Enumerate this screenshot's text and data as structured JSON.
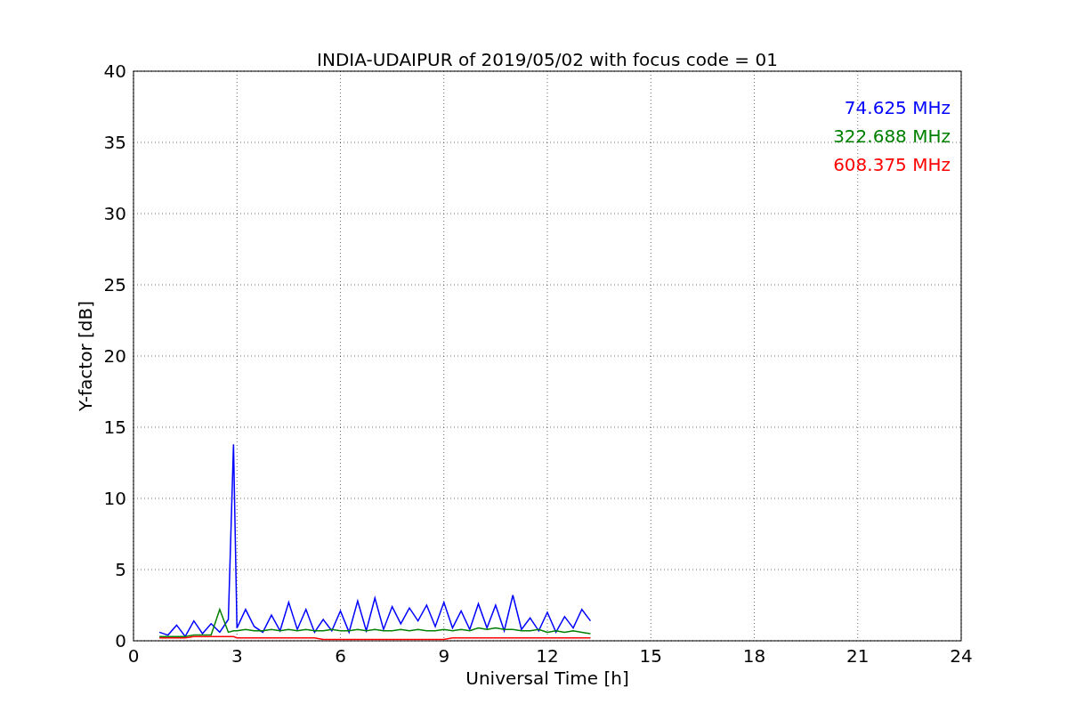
{
  "chart_data": {
    "type": "line",
    "title": "INDIA-UDAIPUR of 2019/05/02 with focus code = 01",
    "xlabel": "Universal Time [h]",
    "ylabel": "Y-factor [dB]",
    "x": [
      0.75,
      1,
      1.25,
      1.5,
      1.75,
      2,
      2.25,
      2.5,
      2.75,
      2.9,
      3,
      3.25,
      3.5,
      3.75,
      4,
      4.25,
      4.5,
      4.75,
      5,
      5.25,
      5.5,
      5.75,
      6,
      6.25,
      6.5,
      6.75,
      7,
      7.25,
      7.5,
      7.75,
      8,
      8.25,
      8.5,
      8.75,
      9,
      9.25,
      9.5,
      9.75,
      10,
      10.25,
      10.5,
      10.75,
      11,
      11.25,
      11.5,
      11.75,
      12,
      12.25,
      12.5,
      12.75,
      13,
      13.25
    ],
    "series": [
      {
        "name": "74.625 MHz",
        "color": "#0000ff",
        "values": [
          0.6,
          0.4,
          1.1,
          0.3,
          1.4,
          0.5,
          1.2,
          0.6,
          1.5,
          13.8,
          0.9,
          2.2,
          1.0,
          0.6,
          1.8,
          0.7,
          2.7,
          0.8,
          2.2,
          0.6,
          1.5,
          0.7,
          2.1,
          0.6,
          2.8,
          0.7,
          3.0,
          0.8,
          2.4,
          1.2,
          2.3,
          1.4,
          2.5,
          1.0,
          2.7,
          0.9,
          2.1,
          0.8,
          2.6,
          0.9,
          2.5,
          0.7,
          3.2,
          0.8,
          1.6,
          0.7,
          2.0,
          0.6,
          1.7,
          0.9,
          2.2,
          1.4
        ]
      },
      {
        "name": "322.688 MHz",
        "color": "#008000",
        "values": [
          0.3,
          0.3,
          0.3,
          0.3,
          0.4,
          0.4,
          0.4,
          2.2,
          0.6,
          0.7,
          0.7,
          0.8,
          0.7,
          0.7,
          0.8,
          0.7,
          0.8,
          0.7,
          0.8,
          0.7,
          0.7,
          0.8,
          0.7,
          0.7,
          0.8,
          0.7,
          0.8,
          0.7,
          0.7,
          0.8,
          0.7,
          0.8,
          0.7,
          0.7,
          0.8,
          0.7,
          0.8,
          0.7,
          0.9,
          0.8,
          0.9,
          0.8,
          0.8,
          0.7,
          0.7,
          0.8,
          0.6,
          0.7,
          0.6,
          0.7,
          0.6,
          0.5
        ]
      },
      {
        "name": "608.375 MHz",
        "color": "#ff0000",
        "values": [
          0.2,
          0.2,
          0.2,
          0.2,
          0.3,
          0.3,
          0.3,
          0.3,
          0.3,
          0.3,
          0.2,
          0.2,
          0.2,
          0.2,
          0.2,
          0.2,
          0.2,
          0.2,
          0.2,
          0.2,
          0.1,
          0.1,
          0.1,
          0.1,
          0.1,
          0.1,
          0.1,
          0.1,
          0.1,
          0.1,
          0.1,
          0.1,
          0.1,
          0.1,
          0.1,
          0.2,
          0.2,
          0.2,
          0.2,
          0.2,
          0.2,
          0.2,
          0.2,
          0.2,
          0.2,
          0.2,
          0.2,
          0.2,
          0.2,
          0.2,
          0.2,
          0.2
        ]
      }
    ],
    "grid": true,
    "xlim": [
      0,
      24
    ],
    "ylim": [
      0,
      40
    ],
    "xticks": [
      0,
      3,
      6,
      9,
      12,
      15,
      18,
      21,
      24
    ],
    "yticks": [
      0,
      5,
      10,
      15,
      20,
      25,
      30,
      35,
      40
    ]
  }
}
